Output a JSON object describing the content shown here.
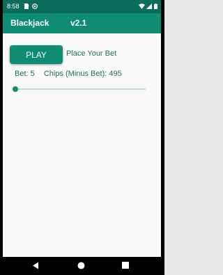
{
  "status_bar": {
    "time": "8:58"
  },
  "app_bar": {
    "title": "Blackjack",
    "version": "v2.1"
  },
  "main": {
    "play_label": "PLAY",
    "bet_prompt": "Place Your Bet",
    "bet_label": "Bet: 5",
    "chips_label": "Chips (Minus Bet): 495",
    "bet_slider_fraction": 0.02
  },
  "colors": {
    "primary": "#0f8c74",
    "primary_dark": "#0b6e5b",
    "text_accent": "#1b6f5f",
    "slider_track": "#b7d9d1"
  },
  "icons": {
    "status_left": [
      "sim-card-icon",
      "at-sign-icon"
    ],
    "status_right": [
      "wifi-icon",
      "signal-icon",
      "battery-icon"
    ],
    "nav": [
      "back-icon",
      "home-icon",
      "recents-icon"
    ]
  }
}
